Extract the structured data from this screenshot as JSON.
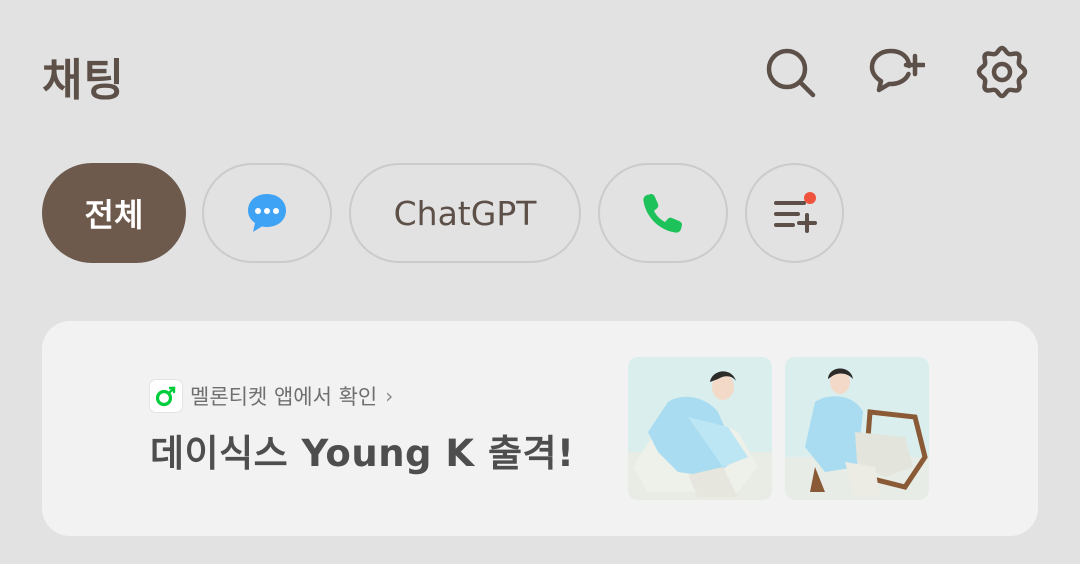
{
  "header": {
    "title": "채팅",
    "icons": [
      "search-icon",
      "new-chat-icon",
      "settings-icon"
    ]
  },
  "filters": [
    {
      "label": "전체",
      "active": true
    },
    {
      "icon": "chat-bubble-icon",
      "active": false
    },
    {
      "label": "ChatGPT",
      "active": false
    },
    {
      "icon": "phone-icon",
      "active": false
    },
    {
      "icon": "edit-filter-icon",
      "active": false
    }
  ],
  "banner": {
    "sub_text": "멜론티켓 앱에서 확인",
    "chevron": "›",
    "title": "데이식스 Young K 출격!",
    "logo": "melon-logo-icon"
  },
  "colors": {
    "background": "#e2e2e2",
    "accent": "#6d5a4d",
    "text": "#5d5049",
    "banner_bg": "#f2f2f2",
    "melon_green": "#00cd3c",
    "phone_green": "#1ec25a",
    "chat_blue": "#3fa3f5",
    "badge_red": "#f0533b"
  }
}
